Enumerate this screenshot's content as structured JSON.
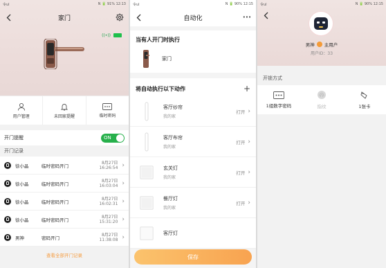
{
  "status": {
    "left": "令ul",
    "s1_right": "N 🔋 91% 12:13",
    "s2_right": "N 🔋 90% 12:15",
    "s3_right": "N 🔋 90% 12:15"
  },
  "screen1": {
    "title": "家门",
    "signal": "((•))",
    "quick": [
      {
        "label": "用户管理",
        "icon": "user-icon"
      },
      {
        "label": "未回家提醒",
        "icon": "bell-icon"
      },
      {
        "label": "临时密码",
        "icon": "keypad-icon"
      }
    ],
    "door_alert_label": "开门提醒",
    "toggle_label": "ON",
    "records_title": "开门记录",
    "records": [
      {
        "name": "徐小晶",
        "type": "临时密码开门",
        "date": "8月27日",
        "time": "16:26:54"
      },
      {
        "name": "徐小晶",
        "type": "临时密码开门",
        "date": "8月27日",
        "time": "16:03:04"
      },
      {
        "name": "徐小晶",
        "type": "临时密码开门",
        "date": "8月27日",
        "time": "16:02:31"
      },
      {
        "name": "徐小晶",
        "type": "临时密码开门",
        "date": "8月27日",
        "time": "15:31:20"
      },
      {
        "name": "男神",
        "type": "密码开门",
        "date": "8月27日",
        "time": "11:38:08"
      }
    ],
    "view_all": "查看全部开门记录"
  },
  "screen2": {
    "title": "自动化",
    "more": "•••",
    "trigger_title": "当有人开门时执行",
    "trigger_device": "家门",
    "actions_title": "将自动执行以下动作",
    "add": "+",
    "actions": [
      {
        "name": "客厅纱帘",
        "room": "我的家",
        "state": "打开",
        "thumb": "curtain"
      },
      {
        "name": "客厅布帘",
        "room": "我的家",
        "state": "打开",
        "thumb": "curtain"
      },
      {
        "name": "玄关灯",
        "room": "我的家",
        "state": "打开",
        "thumb": "switch"
      },
      {
        "name": "餐厅灯",
        "room": "我的家",
        "state": "打开",
        "thumb": "switch"
      },
      {
        "name": "客厅灯",
        "room": "",
        "state": "",
        "thumb": "switch"
      }
    ],
    "save": "保存"
  },
  "screen3": {
    "title": "男神",
    "name": "男神",
    "role": "主用户",
    "user_id": "用户ID：33",
    "unlock_title": "开锁方式",
    "methods": [
      {
        "label": "1组数字密码",
        "icon": "keypad-icon",
        "active": true
      },
      {
        "label": "指纹",
        "icon": "fingerprint-icon",
        "active": false
      },
      {
        "label": "1张卡",
        "icon": "card-icon",
        "active": true
      }
    ]
  }
}
